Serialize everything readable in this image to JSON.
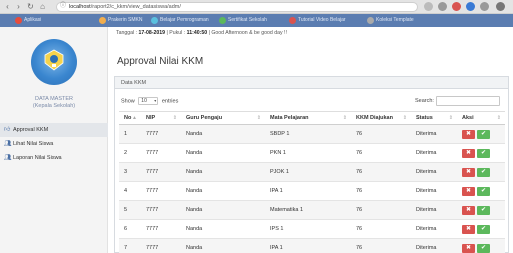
{
  "browser": {
    "url_host": "localhost",
    "url_path": "/raport2/c_kkm/view_datasiswa/adm/",
    "bookmarks": [
      "Aplikasi",
      "Prakerin SMKN",
      "Belajar Pemrograman",
      "Sertifikat Sekolah",
      "Tutorial Video Belajar",
      "Koleksi Template"
    ]
  },
  "sidebar": {
    "title": "DATA MASTER",
    "subtitle": "(Kepala Sekolah)",
    "menu": [
      {
        "label": "Approval KKM",
        "icon": "thumbs-up-icon",
        "active": true
      },
      {
        "label": "Lihat Nilai Siswa",
        "icon": "users-icon",
        "active": false
      },
      {
        "label": "Laporan Nilai Siswa",
        "icon": "users-icon",
        "active": false
      }
    ]
  },
  "topline": {
    "date_label": "Tanggal :",
    "date_value": "17-08-2019",
    "time_label": "| Pukul :",
    "time_value": "11:40:50",
    "greeting": "| Good Afternoon & be good day !!"
  },
  "page_title": "Approval Nilai KKM",
  "panel": {
    "heading": "Data KKM",
    "show_prefix": "Show",
    "show_value": "10",
    "show_suffix": "entries",
    "search_label": "Search:"
  },
  "table": {
    "columns": [
      "No",
      "NIP",
      "Guru Pengaju",
      "Mata Pelajaran",
      "KKM Diajukan",
      "Status",
      "Aksi"
    ],
    "rows": [
      [
        "1",
        "7777",
        "Nanda",
        "SBDP 1",
        "76",
        "Diterima"
      ],
      [
        "2",
        "7777",
        "Nanda",
        "PKN 1",
        "76",
        "Diterima"
      ],
      [
        "3",
        "7777",
        "Nanda",
        "PJOK 1",
        "76",
        "Diterima"
      ],
      [
        "4",
        "7777",
        "Nanda",
        "IPA 1",
        "76",
        "Diterima"
      ],
      [
        "5",
        "7777",
        "Nanda",
        "Matematika 1",
        "76",
        "Diterima"
      ],
      [
        "6",
        "7777",
        "Nanda",
        "IPS 1",
        "76",
        "Diterima"
      ],
      [
        "7",
        "7777",
        "Nanda",
        "IPA 1",
        "76",
        "Diterima"
      ]
    ],
    "reject_glyph": "✖",
    "accept_glyph": "✔"
  },
  "colors": {
    "reject": "#d9534f",
    "accept": "#5cb85c",
    "bookmarks_bar": "#5b7db1"
  }
}
